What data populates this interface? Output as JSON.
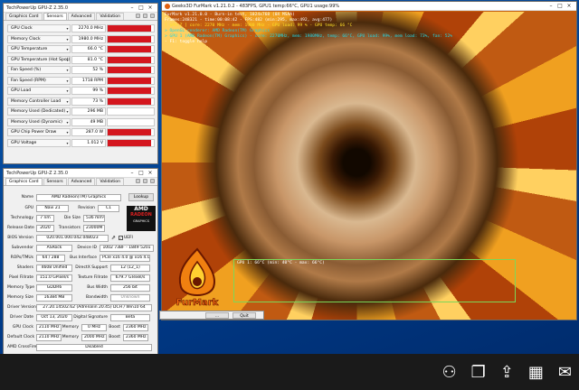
{
  "colors": {
    "graph": "#d4161e",
    "desktop": "#00408e",
    "cyan": "#24d7e6",
    "yellow": "#ffe028",
    "green": "#9df05a"
  },
  "gpuz_sensors": {
    "title": "TechPowerUp GPU-Z 2.35.0",
    "tabs": [
      "Graphics Card",
      "Sensors",
      "Advanced",
      "Validation"
    ],
    "rows": [
      {
        "label": "GPU Clock",
        "value": "2270.0 MHz",
        "level": 0.95
      },
      {
        "label": "Memory Clock",
        "value": "1980.0 MHz",
        "level": 0.95
      },
      {
        "label": "GPU Temperature",
        "value": "66.0 °C",
        "level": 0.95
      },
      {
        "label": "GPU Temperature (Hot Spot)",
        "value": "81.0 °C",
        "level": 0.95
      },
      {
        "label": "Fan Speed (%)",
        "value": "52 %",
        "level": 0.95
      },
      {
        "label": "Fan Speed (RPM)",
        "value": "1718 RPM",
        "level": 0.95
      },
      {
        "label": "GPU Load",
        "value": "99 %",
        "level": 0.95
      },
      {
        "label": "Memory Controller Load",
        "value": "73 %",
        "level": 0.95
      },
      {
        "label": "Memory Used (Dedicated)",
        "value": "296 MB",
        "level": 0.0
      },
      {
        "label": "Memory Used (Dynamic)",
        "value": "49 MB",
        "level": 0.0
      },
      {
        "label": "GPU Chip Power Draw",
        "value": "287.0 W",
        "level": 0.95
      },
      {
        "label": "GPU Voltage",
        "value": "1.012 V",
        "level": 0.95
      }
    ]
  },
  "gpuz_card": {
    "title": "TechPowerUp GPU-Z 2.35.0",
    "tabs": [
      "Graphics Card",
      "Sensors",
      "Advanced",
      "Validation"
    ],
    "name_label": "Name",
    "name": "AMD Radeon(TM) Graphics",
    "lookup": "Lookup",
    "gpu_label": "GPU",
    "gpu": "Navi 21",
    "revision_label": "Revision",
    "revision": "C1",
    "tech_label": "Technology",
    "tech": "7 nm",
    "die_label": "Die Size",
    "die": "536 mm²",
    "release_label": "Release Date",
    "release": "2020",
    "transistors_label": "Transistors",
    "transistors": "23000M",
    "bios_label": "BIOS Version",
    "bios": "020.001.000.042.048023",
    "uefi": "UEFI",
    "subvendor_label": "Subvendor",
    "subvendor": "ASRock",
    "devid_label": "Device ID",
    "devid": "1002 73BF - 1849 5201",
    "rops_label": "ROPs/TMUs",
    "rops": "64 / 288",
    "bus_label": "Bus Interface",
    "bus": "PCIe x16 4.0 @ x16 4.0",
    "shaders_label": "Shaders",
    "shaders": "4608 Unified",
    "dx_label": "DirectX Support",
    "dx": "12 (12_1)",
    "pixel_label": "Pixel Fillrate",
    "pixel": "151.0 GPixel/s",
    "texture_label": "Texture Fillrate",
    "texture": "679.7 GTexel/s",
    "memtype_label": "Memory Type",
    "memtype": "GDDR6",
    "buswidth_label": "Bus Width",
    "buswidth": "256 bit",
    "memsize_label": "Memory Size",
    "memsize": "16384 MB",
    "bandwidth_label": "Bandwidth",
    "bandwidth": "Unknown",
    "driver_label": "Driver Version",
    "driver": "27.20.14502.62 (Adrenalin 20.45) DCH / Win10 64",
    "driverdate_label": "Driver Date",
    "driverdate": "Oct 13, 2020",
    "digsig_label": "Digital Signature",
    "digsig": "Beta",
    "gpuclock_label": "GPU Clock",
    "gpuclock": "2110 MHz",
    "memory_label": "Memory",
    "memclock": "0 MHz",
    "boost_label": "Boost",
    "boost": "2360 MHz",
    "defclock_label": "Default Clock",
    "defclock": "2110 MHz",
    "defmem": "2000 MHz",
    "defboost": "2360 MHz",
    "crossfire_label": "AMD CrossFire",
    "crossfire": "Disabled",
    "computing_label": "Computing",
    "computing": [
      "OpenCL",
      "CUDA",
      "DirectCompute",
      "DirectML"
    ],
    "tech2_label": "Technologies",
    "technologies": [
      "Vulkan",
      "Ray Tracing",
      "PhysX",
      "OpenGL 4.6"
    ],
    "select": "AMD Radeon(TM) Graphics",
    "close": "Close",
    "badge_top": "AMD",
    "badge_mid": "RADEON",
    "badge_bot": "GRAPHICS"
  },
  "furmark": {
    "title": "Geeks3D FurMark v1.21.0.2 - 483FPS, GPU1 temp:66°C, GPU1 usage:99%",
    "overlay": [
      {
        "t": "FurMark v1.21.0.0 - Burn-in test, 1024x768 (0X MSAA)",
        "c": "w"
      },
      {
        "t": "Frames:248321 - time:00:08:42 - FPS:482 (min:295, max:492, avg:477)",
        "c": "w"
      },
      {
        "t": "[ GPU-Z ] core: 2270 MHz - mem: 1980 MHz - GPU load: 99 % - GPU temp: 66 °C",
        "c": "y"
      },
      {
        "t": "> OpenGL renderer: AMD Radeon(TM) Graphics",
        "c": "c"
      },
      {
        "t": "> GPU 1 (AMD Radeon(TM) Graphics) - core: 2270MHz, mem: 1980MHz, temp: 66°C, GPU load: 99%, mem load: 73%, fan: 52%",
        "c": "c"
      },
      {
        "t": "- F1: toggle help",
        "c": "w"
      }
    ],
    "temp_label": "GPU 1: 66°C (min: 40°C - max: 66°C)",
    "logo_text": "FurMark"
  },
  "bottom_win": {
    "btn1": "...",
    "btn2": "Quit"
  }
}
